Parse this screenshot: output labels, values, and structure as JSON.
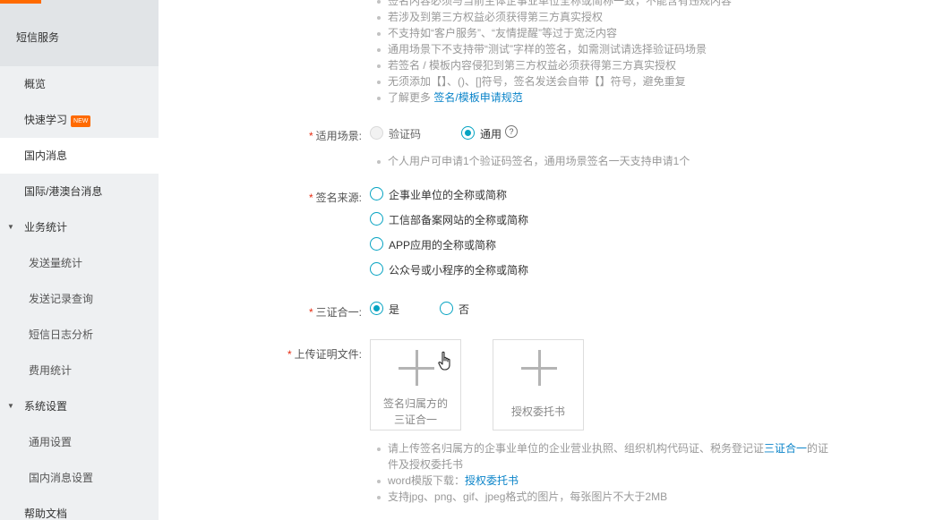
{
  "sidebar": {
    "title": "短信服务",
    "items": [
      {
        "label": "概览"
      },
      {
        "label": "快速学习",
        "badge": "NEW"
      },
      {
        "label": "国内消息"
      },
      {
        "label": "国际/港澳台消息"
      },
      {
        "label": "业务统计"
      },
      {
        "label": "发送量统计"
      },
      {
        "label": "发送记录查询"
      },
      {
        "label": "短信日志分析"
      },
      {
        "label": "费用统计"
      },
      {
        "label": "系统设置"
      },
      {
        "label": "通用设置"
      },
      {
        "label": "国内消息设置"
      },
      {
        "label": "帮助文档"
      }
    ],
    "active_item": "国内消息"
  },
  "top_notes": [
    "签名内容必须与当前主体企事业单位全称或简称一致，不能含有违规内容",
    "若涉及到第三方权益必须获得第三方真实授权",
    "不支持如“客户服务”、“友情提醒”等过于宽泛内容",
    "通用场景下不支持带“测试”字样的签名，如需测试请选择验证码场景",
    "若签名 / 模板内容侵犯到第三方权益必须获得第三方真实授权",
    "无须添加【】、()、[]符号，签名发送会自带【】符号，避免重复",
    "了解更多"
  ],
  "top_notes_link": "签名/模板申请规范",
  "scene": {
    "label": "适用场景:",
    "options": [
      "验证码",
      "通用"
    ],
    "selected": "通用",
    "help_icon": "?",
    "note": "个人用户可申请1个验证码签名，通用场景签名一天支持申请1个"
  },
  "source": {
    "label": "签名来源:",
    "options": [
      "企事业单位的全称或简称",
      "工信部备案网站的全称或简称",
      "APP应用的全称或简称",
      "公众号或小程序的全称或简称"
    ]
  },
  "three_in_one": {
    "label": "三证合一:",
    "options": [
      "是",
      "否"
    ],
    "selected": "是"
  },
  "upload": {
    "label": "上传证明文件:",
    "boxes": [
      {
        "caption_line1": "签名归属方的",
        "caption_line2": "三证合一"
      },
      {
        "caption_line1": "授权委托书"
      }
    ],
    "notes": {
      "line1_prefix": "请上传签名归属方的企事业单位的企业营业执照、组织机构代码证、税务登记证",
      "line1_link": "三证合一",
      "line1_suffix": "的证",
      "line1_cont": "件及授权委托书",
      "line2_prefix": "word模版下载：",
      "line2_link": "授权委托书",
      "line3": "支持jpg、png、gif、jpeg格式的图片，每张图片不大于2MB"
    }
  },
  "colors": {
    "accent": "#06a3c2",
    "link": "#0b84c9",
    "brand": "#ff6a00",
    "required": "#e62a10"
  }
}
